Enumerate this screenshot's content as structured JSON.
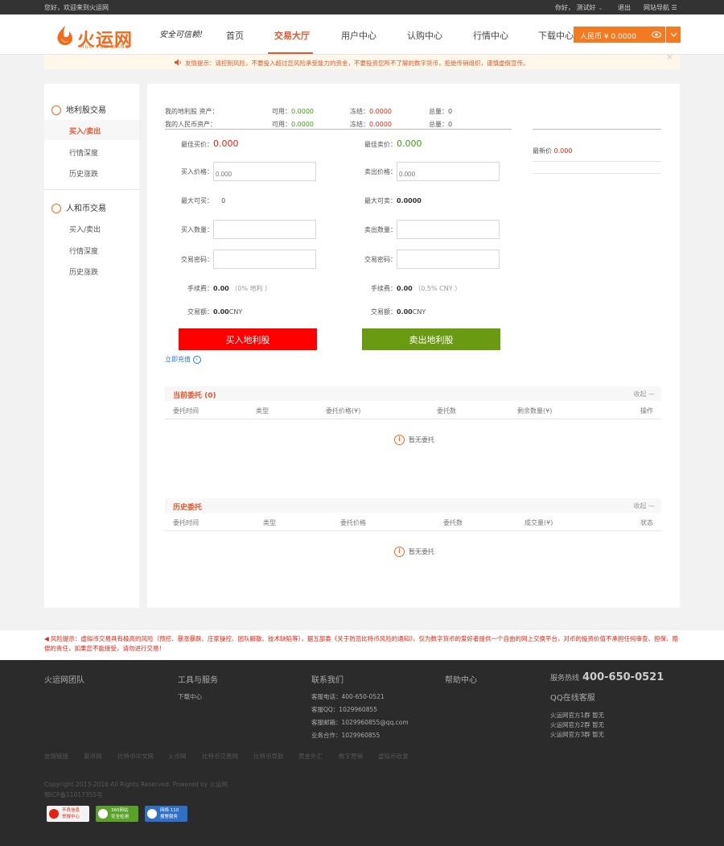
{
  "topbar": {
    "welcome": "您好，欢迎来到火运网",
    "user": "你好，  测试好",
    "logout": "退出",
    "sitenav": "网站导航"
  },
  "header": {
    "logo_text": "火运网",
    "logo_sub": "HUO YUN WANG",
    "slogan": "安全可信赖!",
    "nav": [
      "首页",
      "交易大厅",
      "用户中心",
      "认购中心",
      "行情中心",
      "下载中心"
    ],
    "balance_label": "人民币 ¥ 0.0000"
  },
  "notice": {
    "text": "友情提示：请控制风险，不要投入超过您风险承受能力的资金，不要投资您所不了解的数字货币，拒绝传销组织，谨慎虚假宣传。"
  },
  "sidebar": {
    "groups": [
      {
        "title": "地利股交易",
        "items": [
          "买入/卖出",
          "行情深度",
          "历史涨跌"
        ]
      },
      {
        "title": "人和币交易",
        "items": [
          "买入/卖出",
          "行情深度",
          "历史涨跌"
        ]
      }
    ]
  },
  "assets": {
    "rows": [
      {
        "label": "我的地利股 资产：",
        "avail_label": "可用：",
        "avail": "0.0000",
        "frozen_label": "冻结：",
        "frozen": "0.0000",
        "total_label": "总量：",
        "total": "0"
      },
      {
        "label": "我的人民币资产：",
        "avail_label": "可用：",
        "avail": "0.0000",
        "frozen_label": "冻结：",
        "frozen": "0.0000",
        "total_label": "总量：",
        "total": "0"
      }
    ]
  },
  "market": {
    "latest_label": "最新价",
    "latest_value": "0.000"
  },
  "buy": {
    "best_label": "最佳买价：",
    "best_value": "0.000",
    "price_label": "买入价格：",
    "price_placeholder": "0.000",
    "max_label": "最大可买：",
    "max_value": "0",
    "qty_label": "买入数量：",
    "pwd_label": "交易密码：",
    "fee_label": "手续费：",
    "fee_value": "0.00",
    "fee_note": "（0% 地利 ）",
    "amount_label": "交易额：",
    "amount_value": "0.00",
    "amount_unit": "CNY",
    "button": "买入地利股"
  },
  "sell": {
    "best_label": "最佳卖价：",
    "best_value": "0.000",
    "price_label": "卖出价格：",
    "price_placeholder": "0.000",
    "max_label": "最大可卖：",
    "max_value": "0.0000",
    "qty_label": "卖出数量：",
    "pwd_label": "交易密码：",
    "fee_label": "手续费：",
    "fee_value": "0.00",
    "fee_note": "（0.5% CNY ）",
    "amount_label": "交易额：",
    "amount_value": "0.00",
    "amount_unit": "CNY",
    "button": "卖出地利股"
  },
  "recharge_link": "立即充值",
  "current_orders": {
    "title": "当前委托",
    "count": "(0)",
    "toggle": "收起 —",
    "columns": [
      "委托时间",
      "类型",
      "委托价格(¥)",
      "委托数",
      "剩余数量(¥)",
      "操作"
    ],
    "empty": "暂无委托"
  },
  "history_orders": {
    "title": "历史委托",
    "toggle": "收起 —",
    "columns": [
      "委托时间",
      "类型",
      "委托价格",
      "委托数",
      "成交量(¥)",
      "状态"
    ],
    "empty": "暂无委托"
  },
  "risk": {
    "text": "风险提示：虚拟币交易具有极高的风险（预挖、暴涨暴跌、庄家操控、团队解散、技术缺陷等），据五部委《关于防范比特币风险的通知》，仅为数字货币的爱好者提供一个自由的网上交换平台，对币的投资价值不承担任何审查、担保、赔偿的责任，如果您不能接受，请勿进行交易！"
  },
  "footer": {
    "col1_title": "火运网团队",
    "col2_title": "工具与服务",
    "col2_items": [
      "下载中心"
    ],
    "col3_title": "联系我们",
    "col3_items": [
      "客服电话：400-650-0521",
      "客服QQ：1029960855",
      "客服邮箱：1029960855@qq.com",
      "业务合作：1029960855"
    ],
    "col4_title": "帮助中心",
    "hotline_label": "服务热线",
    "hotline": "400-650-0521",
    "qq_title": "QQ在线客服",
    "qq_groups": [
      "火运网官方1群 暂无",
      "火运网官方2群 暂无",
      "火运网官方3群 暂无"
    ],
    "links": [
      "友情链接",
      "莱币网",
      "比特币中文网",
      "火币网",
      "比特币交易网",
      "比特币导航",
      "黄金外汇",
      "数字营销",
      "虚拟币收录"
    ],
    "copyright": "Copyright 2013-2016 All Rights Reserved. Powered by 火运网",
    "icp": "鄂ICP备11017355号",
    "badges": [
      {
        "line1": "不良信息",
        "line2": "举报中心"
      },
      {
        "line1": "360网站",
        "line2": "安全检测"
      },
      {
        "line1": "网络 110",
        "line2": "报警服务"
      }
    ]
  },
  "colors": {
    "accent": "#f26b1d",
    "buy_button": "#ff0000",
    "sell_button": "#6a9a12",
    "available": "#3a9e0f",
    "frozen": "#e8210f",
    "footer_bg": "#2b2b2b",
    "topbar_bg": "#333333"
  }
}
